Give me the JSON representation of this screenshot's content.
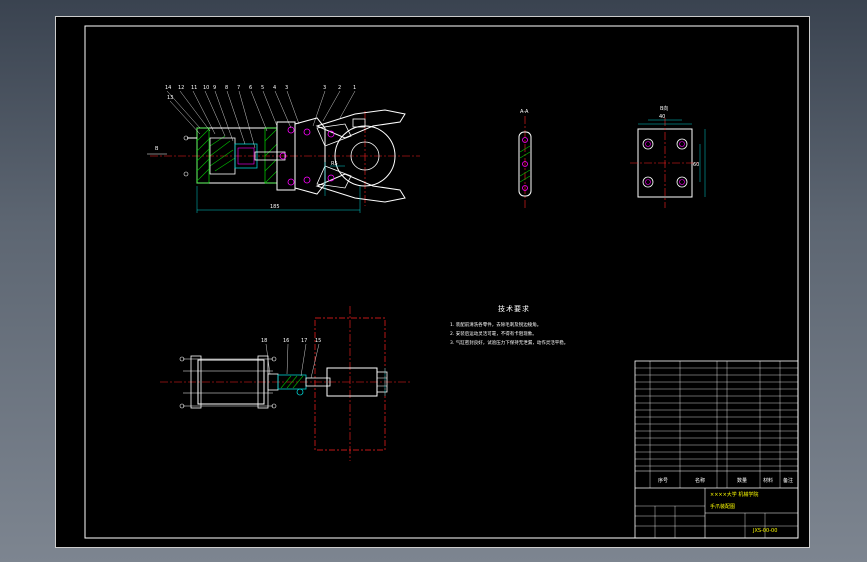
{
  "notes": {
    "title": "技术要求",
    "items": [
      "1. 装配前清洗各零件，去除毛刺及锐边棱角。",
      "2. 安装后运动灵活可靠，不得有卡阻现象。",
      "3. 气缸密封良好，试验压力下保持无泄漏，动作灵活平稳。"
    ]
  },
  "views": {
    "section_label": "A-A",
    "top_label": "B向",
    "arrow_label": "B"
  },
  "title_block": {
    "drawing_name": "手爪装配图",
    "drawing_number": "JXS-00-00",
    "school": "××××大学 机械学院",
    "col_seq": "序号",
    "col_name": "名称",
    "col_qty": "数量",
    "col_material": "材料",
    "col_note": "备注"
  },
  "colors": {
    "sheet": "#000000",
    "line": "#ffffff",
    "center": "#ff2020",
    "hatch": "#00c000",
    "dim": "#00d0d0",
    "part": "#ff00ff"
  }
}
